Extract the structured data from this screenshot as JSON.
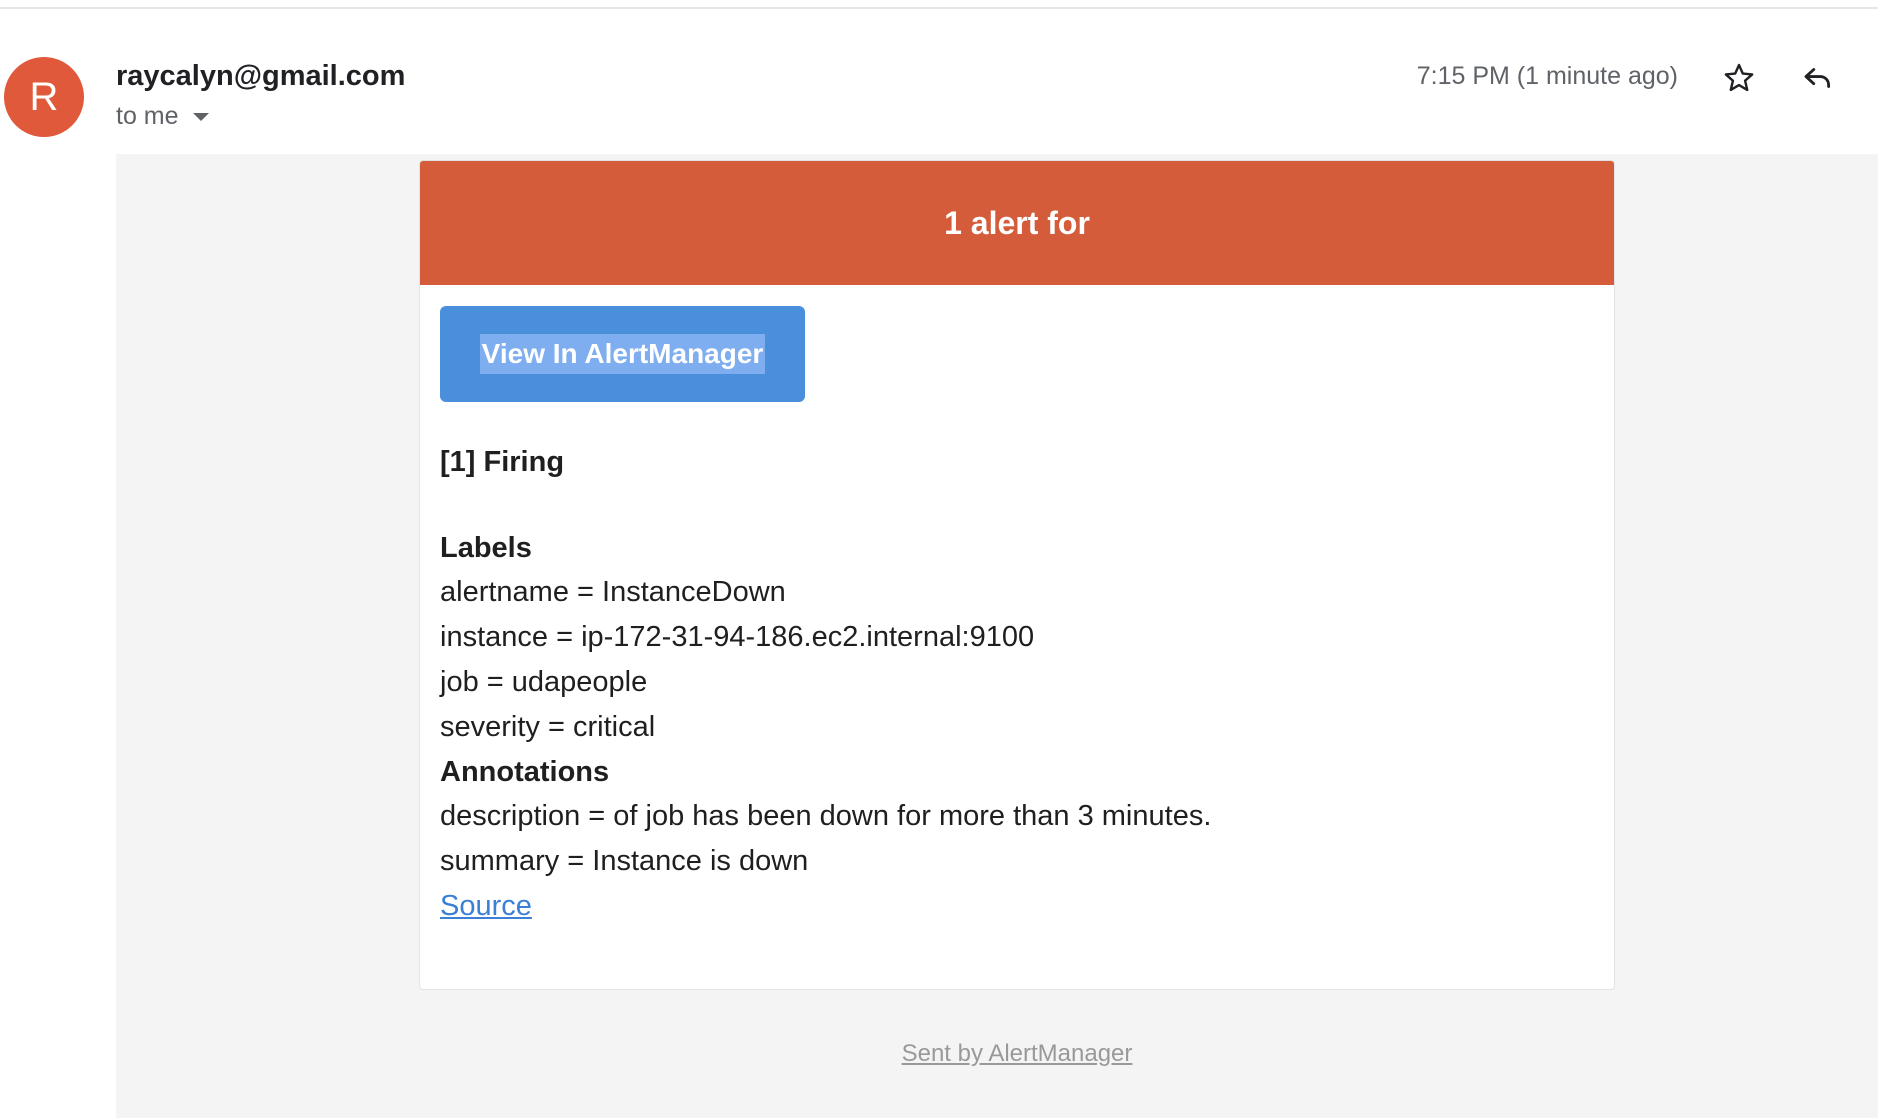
{
  "email": {
    "avatar_letter": "R",
    "avatar_color": "#e0593a",
    "sender": "raycalyn@gmail.com",
    "recipient_label": "to me",
    "timestamp": "7:15 PM (1 minute ago)",
    "icons": {
      "star": "star-outline-icon",
      "reply": "reply-arrow-icon",
      "recipient_dropdown": "caret-down-icon"
    }
  },
  "alert": {
    "header_title": "1 alert for",
    "header_color": "#d45c3b",
    "button_label": "View In AlertManager",
    "button_color": "#4a8fdc",
    "firing_label": "[1] Firing",
    "labels_heading": "Labels",
    "labels": [
      "alertname = InstanceDown",
      "instance = ip-172-31-94-186.ec2.internal:9100",
      "job = udapeople",
      "severity = critical"
    ],
    "annotations_heading": "Annotations",
    "annotations": [
      "description =  of job  has been down for more than 3 minutes.",
      "summary = Instance  is down"
    ],
    "source_link": "Source",
    "link_color": "#3b7fd6"
  },
  "footer": {
    "sent_by": "Sent by AlertManager"
  }
}
